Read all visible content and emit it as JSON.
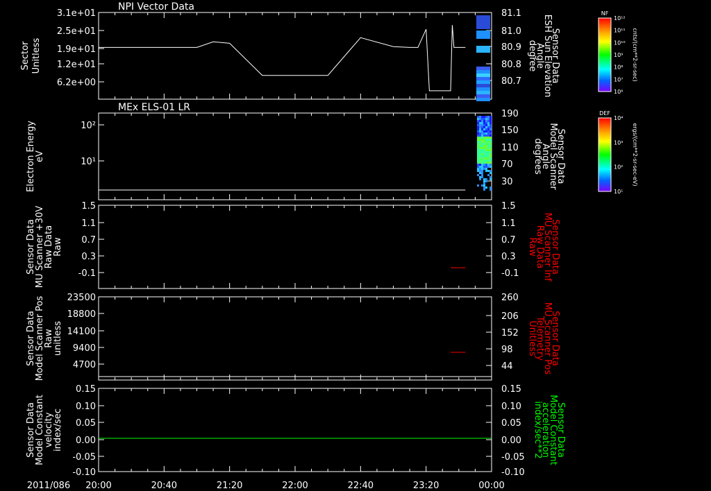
{
  "colors": {
    "white": "#ffffff",
    "red": "#ff0000",
    "green": "#00ff00",
    "background": "#000000"
  },
  "colorbars": [
    {
      "top_label": "NF",
      "tick_labels": [
        "10¹²",
        "10¹¹",
        "10¹⁰",
        "10⁹",
        "10⁸",
        "10⁷",
        "10⁶"
      ],
      "unit_label": "cnts/(cm**2-sr-sec)"
    },
    {
      "top_label": "DEF",
      "tick_labels": [
        "10⁴",
        "10³",
        "10²",
        "10¹"
      ],
      "unit_label": "ergs/(cm**2-sr-sec-eV)"
    }
  ],
  "time_axis": {
    "date_label": "2011/086",
    "tick_labels": [
      "20:00",
      "20:40",
      "21:20",
      "22:00",
      "22:40",
      "23:20",
      "00:00"
    ]
  },
  "chart_data": [
    {
      "type": "line",
      "title": "NPI Vector Data",
      "ylabel": "Sector\nUnitless",
      "y_tick_labels": [
        "3.1e+01",
        "2.5e+01",
        "1.9e+01",
        "1.2e+01",
        "6.2e+00"
      ],
      "right_label": "Sensor Data\nESH Sun Elevation\nAngle\ndegree",
      "right_tick_labels": [
        "81.1",
        "81.0",
        "80.9",
        "80.8",
        "80.7"
      ],
      "ylim": [
        0,
        31
      ],
      "series": [
        {
          "x": [
            "20:00",
            "21:00",
            "21:10",
            "21:20",
            "21:40",
            "22:20",
            "22:40",
            "23:00",
            "23:10",
            "23:15",
            "23:20",
            "23:22",
            "23:35",
            "23:36",
            "23:37",
            "23:44"
          ],
          "y": [
            18.5,
            18.5,
            20.5,
            20,
            8.5,
            8.5,
            22,
            18.8,
            18.5,
            18.5,
            25,
            3,
            3,
            26.5,
            18.5,
            18.5
          ]
        }
      ]
    },
    {
      "type": "heatmap",
      "title": "MEx ELS-01 LR",
      "ylabel": "Electron Energy\neV",
      "y_tick_labels": [
        "10²",
        "10¹"
      ],
      "right_label": "Sensor Data\nModel Scanner\nAngle\ndegrees",
      "right_tick_labels": [
        "190",
        "150",
        "110",
        "70",
        "30"
      ],
      "series": [
        {
          "x": [
            "20:00",
            "23:44"
          ],
          "y": [
            5,
            5
          ]
        }
      ]
    },
    {
      "type": "line",
      "ylabel": "Sensor Data\nMU Scanner +30V\nRaw Data\nRaw",
      "y_tick_labels": [
        "1.5",
        "1.1",
        "0.7",
        "0.3",
        "-0.1"
      ],
      "right_label": "Sensor Data\nMU Scanner Inf\nRaw Data\nRaw",
      "right_tick_labels": [
        "1.5",
        "1.1",
        "0.7",
        "0.3",
        "-0.1"
      ],
      "ylim": [
        -0.3,
        1.5
      ],
      "series": [
        {
          "x": [
            "23:35",
            "23:44"
          ],
          "y": [
            0.0,
            0.0
          ]
        }
      ]
    },
    {
      "type": "line",
      "ylabel": "Sensor Data\nModel Scanner Pos\nRaw\nunitless",
      "y_tick_labels": [
        "23500",
        "18800",
        "14100",
        "9400",
        "4700"
      ],
      "right_label": "Sensor Data\nMU Scanner Pos\nTelemetry\nUnitless",
      "right_tick_labels": [
        "260",
        "206",
        "152",
        "98",
        "44"
      ],
      "ylim": [
        0,
        23500
      ],
      "series": [
        {
          "x": [
            "23:35",
            "23:44"
          ],
          "y": [
            85,
            85
          ]
        }
      ]
    },
    {
      "type": "line",
      "ylabel": "Sensor Data\nModel Constant\nvelocity\nindex/sec",
      "y_tick_labels": [
        "0.15",
        "0.10",
        "0.05",
        "0.00",
        "-0.05",
        "-0.10"
      ],
      "right_label": "Sensor Data\nModel Constant\nacceleration\nindex/sec**2",
      "right_tick_labels": [
        "0.15",
        "0.10",
        "0.05",
        "0.00",
        "-0.05",
        "-0.10"
      ],
      "ylim": [
        -0.1,
        0.15
      ],
      "series": [
        {
          "x": [
            "20:00",
            "00:00"
          ],
          "y": [
            0,
            0
          ]
        }
      ]
    }
  ]
}
